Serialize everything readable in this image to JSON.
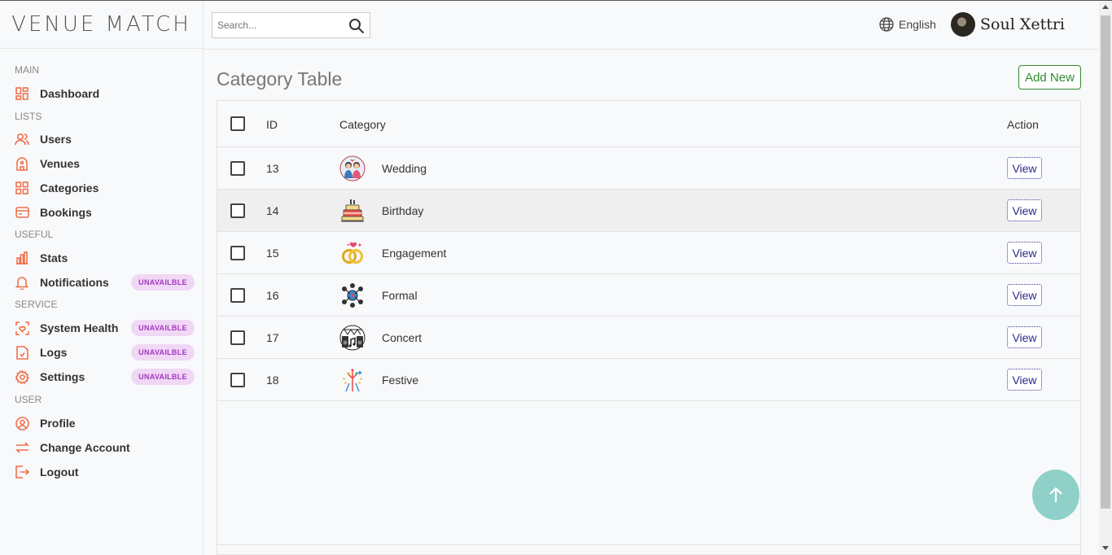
{
  "brand": {
    "logo_text": "VENUE MATCH"
  },
  "search": {
    "placeholder": "Search..."
  },
  "header": {
    "language": "English",
    "user_name": "Soul Xettri"
  },
  "sidebar": {
    "sections": [
      {
        "title": "MAIN",
        "items": [
          {
            "label": "Dashboard",
            "icon": "dashboard-icon"
          }
        ]
      },
      {
        "title": "LISTS",
        "items": [
          {
            "label": "Users",
            "icon": "users-icon"
          },
          {
            "label": "Venues",
            "icon": "venue-icon"
          },
          {
            "label": "Categories",
            "icon": "categories-icon"
          },
          {
            "label": "Bookings",
            "icon": "bookings-icon"
          }
        ]
      },
      {
        "title": "USEFUL",
        "items": [
          {
            "label": "Stats",
            "icon": "stats-icon"
          },
          {
            "label": "Notifications",
            "icon": "bell-icon",
            "badge": "UNAVAILBLE"
          }
        ]
      },
      {
        "title": "SERVICE",
        "items": [
          {
            "label": "System Health",
            "icon": "health-icon",
            "badge": "UNAVAILBLE"
          },
          {
            "label": "Logs",
            "icon": "logs-icon",
            "badge": "UNAVAILBLE"
          },
          {
            "label": "Settings",
            "icon": "gear-icon",
            "badge": "UNAVAILBLE"
          }
        ]
      },
      {
        "title": "USER",
        "items": [
          {
            "label": "Profile",
            "icon": "profile-icon"
          },
          {
            "label": "Change Account",
            "icon": "swap-icon"
          },
          {
            "label": "Logout",
            "icon": "logout-icon"
          }
        ]
      }
    ]
  },
  "main": {
    "title": "Category Table",
    "add_button": "Add New",
    "table": {
      "headers": {
        "id": "ID",
        "category": "Category",
        "action": "Action"
      },
      "view_label": "View",
      "rows": [
        {
          "id": "13",
          "name": "Wedding",
          "icon": "wedding-icon"
        },
        {
          "id": "14",
          "name": "Birthday",
          "icon": "birthday-cake-icon"
        },
        {
          "id": "15",
          "name": "Engagement",
          "icon": "rings-icon"
        },
        {
          "id": "16",
          "name": "Formal",
          "icon": "formal-icon"
        },
        {
          "id": "17",
          "name": "Concert",
          "icon": "concert-icon"
        },
        {
          "id": "18",
          "name": "Festive",
          "icon": "fireworks-icon"
        }
      ]
    }
  },
  "colors": {
    "accent": "#f0704a",
    "badge_bg": "#f0d8f5",
    "badge_text": "#a635c4",
    "add_button": "#2e8b2e",
    "fab": "#8fd0c8"
  }
}
